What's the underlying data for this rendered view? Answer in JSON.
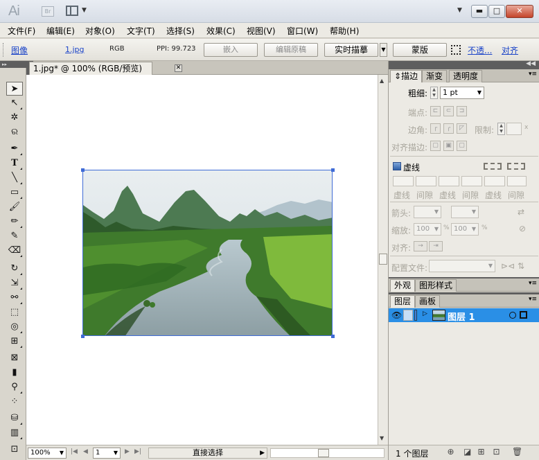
{
  "titlebar": {
    "app_logo": "Ai",
    "bridge_logo": "Br",
    "icons": [
      "workspace-layout-icon",
      "minimize-icon",
      "maximize-icon",
      "close-icon"
    ],
    "min_glyph": "▬",
    "max_glyph": "□",
    "close_glyph": "✕"
  },
  "menubar": {
    "items": [
      "文件(F)",
      "编辑(E)",
      "对象(O)",
      "文字(T)",
      "选择(S)",
      "效果(C)",
      "视图(V)",
      "窗口(W)",
      "帮助(H)"
    ]
  },
  "controlbar": {
    "object_type": "图像",
    "filename": "1.jpg",
    "color_mode": "RGB",
    "ppi": "PPI: 99.723",
    "embed": "嵌入",
    "edit_original": "编辑原稿",
    "live_trace": "实时描摹",
    "mask": "蒙版",
    "opacity": "不透...",
    "align": "对齐"
  },
  "document": {
    "tab_title": "1.jpg* @ 100% (RGB/预览)",
    "close_glyph": "✕"
  },
  "statusbar": {
    "zoom": "100%",
    "page": "1",
    "current_tool": "直接选择"
  },
  "stroke_panel": {
    "tabs": [
      "描边",
      "渐变",
      "透明度"
    ],
    "weight_label": "粗细:",
    "weight_value": "1 pt",
    "cap_label": "端点:",
    "corner_label": "边角:",
    "limit_label": "限制:",
    "limit_unit": "x",
    "align_label": "对齐描边:",
    "dashed_label": "虚线",
    "dash_labels": [
      "虚线",
      "间隙",
      "虚线",
      "间隙",
      "虚线",
      "间隙"
    ],
    "arrow_label": "箭头:",
    "scale_label": "缩放:",
    "scale_start": "100",
    "scale_end": "100",
    "percent": "%",
    "align_arrow_label": "对齐:",
    "profile_label": "配置文件:"
  },
  "appearance_panel": {
    "tabs": [
      "外观",
      "图形样式"
    ]
  },
  "layers_panel": {
    "tabs": [
      "图层",
      "画板"
    ],
    "layer_name": "图层 1",
    "footer_count": "1 个图层"
  }
}
